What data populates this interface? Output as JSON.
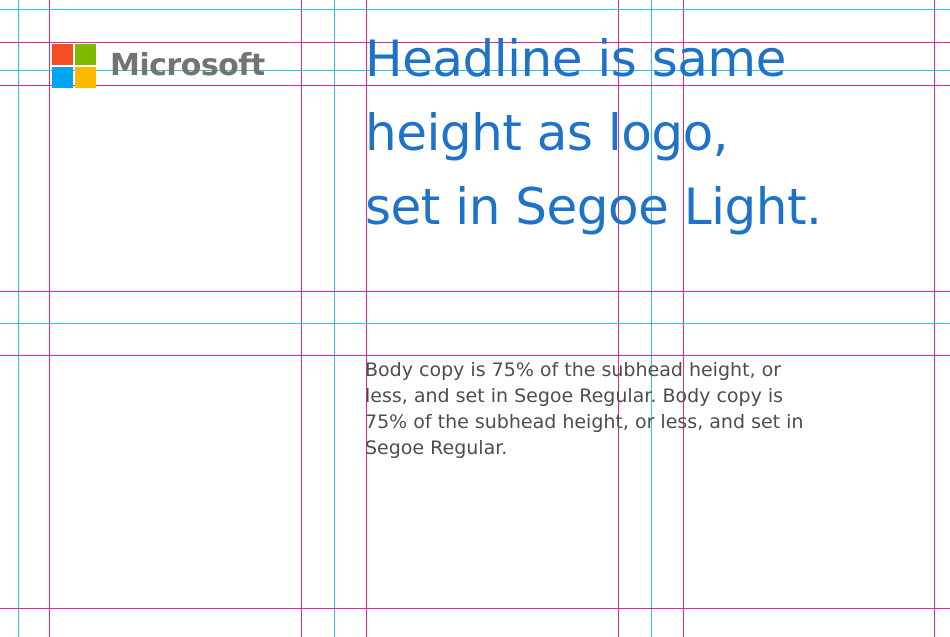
{
  "logo": {
    "wordmark": "Microsoft",
    "square_colors": [
      "#f25022",
      "#7fba00",
      "#00a4ef",
      "#ffb900"
    ]
  },
  "headline": {
    "lines": [
      "Headline is same",
      "height as logo,",
      "set in Segoe Light."
    ],
    "color": "#1e72c7"
  },
  "body_copy": {
    "lines": [
      "Body copy is 75% of the subhead height, or",
      "less, and set in Segoe Regular. Body copy is",
      "75% of the subhead height, or less, and set in",
      "Segoe Regular."
    ],
    "color": "#4d4d4d"
  },
  "guides": {
    "colors": {
      "primary": "#e0279a",
      "secondary": "#33c3d8"
    }
  }
}
